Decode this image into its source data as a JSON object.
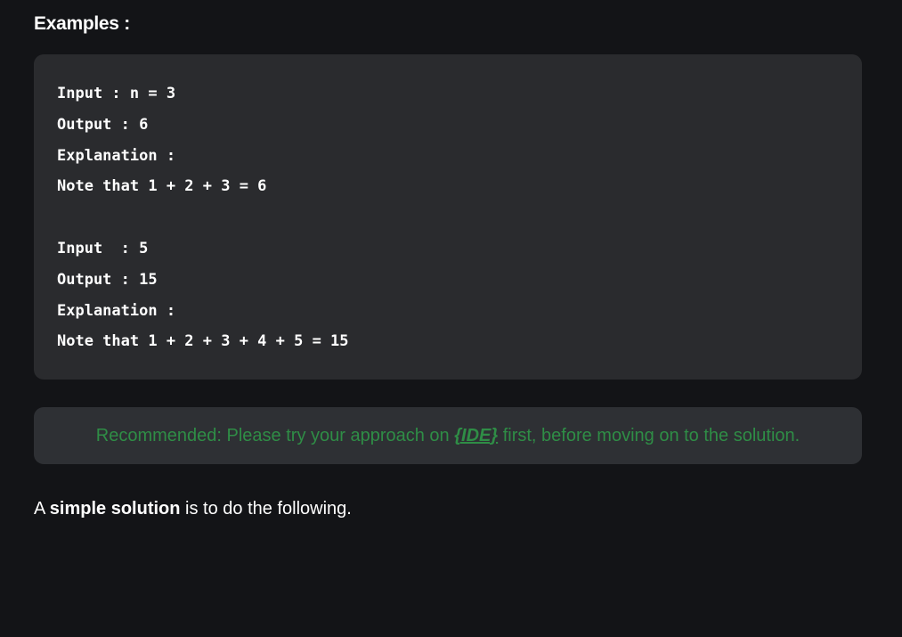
{
  "examples_heading": "Examples :",
  "code_lines": [
    "Input : n = 3",
    "Output : 6",
    "Explanation :",
    "Note that 1 + 2 + 3 = 6",
    "",
    "Input  : 5",
    "Output : 15",
    "Explanation :",
    "Note that 1 + 2 + 3 + 4 + 5 = 15"
  ],
  "recommended": {
    "before": "Recommended: Please try your approach on ",
    "link": "{IDE}",
    "after": " first, before moving on to the solution."
  },
  "solution_text": {
    "prefix": "A ",
    "bold": "simple solution",
    "suffix": " is to do the following."
  },
  "colors": {
    "background": "#131417",
    "code_background": "#2a2b2e",
    "recommend_background": "#2e3034",
    "accent_green": "#2f8d46"
  }
}
